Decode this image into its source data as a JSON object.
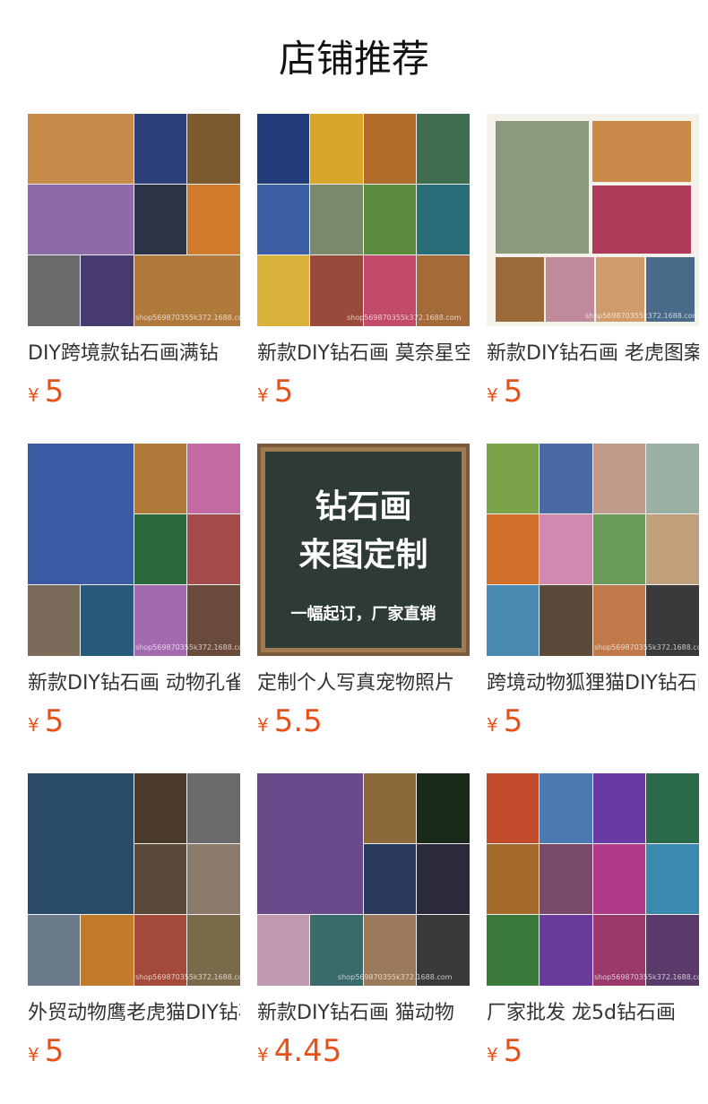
{
  "header": {
    "title": "店铺推荐"
  },
  "products": [
    {
      "title": "DIY跨境款钻石画满钻",
      "currency": "¥",
      "price": "5",
      "watermark": "shop569870355k372.1688.com",
      "tiles": [
        "#c98b4a",
        "#2c3f7a",
        "#7a5a2e",
        "#8d6aa8",
        "#2b3346",
        "#d07a2c",
        "#6a6a6a",
        "#463a6e",
        "#b07a3c"
      ]
    },
    {
      "title": "新款DIY钻石画 莫奈星空",
      "currency": "¥",
      "price": "5",
      "watermark": "shop569870355k372.1688.com",
      "tiles": [
        "#233d7a",
        "#d9a62b",
        "#b06a2a",
        "#3f6e4e",
        "#3e5fa3",
        "#7a8a6a",
        "#5c8a3e",
        "#2a6e7a",
        "#d9b23b",
        "#9a4a3a",
        "#c24a6a",
        "#a36a3a"
      ]
    },
    {
      "title": "新款DIY钻石画 老虎图案",
      "currency": "¥",
      "price": "5",
      "watermark": "shop569870355k372.1688.com",
      "tiles": [
        "#8a9a7a",
        "#c98a4a",
        "#b03a5a",
        "#9a6a3a",
        "#c08a9a",
        "#d09a6a",
        "#4a6a8a"
      ]
    },
    {
      "title": "新款DIY钻石画 动物孔雀",
      "currency": "¥",
      "price": "5",
      "watermark": "shop569870355k372.1688.com",
      "tiles": [
        "#3a5aa3",
        "#b07a3a",
        "#c46aa3",
        "#2a6a3a",
        "#a34a4a",
        "#7a6a5a",
        "#2a5a7a",
        "#a36ab0",
        "#6a4a3a"
      ]
    },
    {
      "title": "定制个人写真宠物照片",
      "currency": "¥",
      "price": "5.5",
      "custom": {
        "line1": "钻石画",
        "line2": "来图定制",
        "line3": "一幅起订，厂家直销"
      }
    },
    {
      "title": "跨境动物狐狸猫DIY钻石画",
      "currency": "¥",
      "price": "5",
      "watermark": "shop569870355k372.1688.com",
      "tiles": [
        "#7aa34a",
        "#4a6aa3",
        "#c09a8a",
        "#9ab0a3",
        "#d0702a",
        "#d08ab0",
        "#6a9a5a",
        "#c0a07a",
        "#4a8ab0",
        "#5a4a3a",
        "#c07a4a",
        "#3a3a3a"
      ]
    },
    {
      "title": "外贸动物鹰老虎猫DIY钻石画",
      "currency": "¥",
      "price": "5",
      "watermark": "shop569870355k372.1688.com",
      "tiles": [
        "#2a4a6a",
        "#4a3a2a",
        "#6a6a6a",
        "#5a4a3a",
        "#8a7a6a",
        "#6a7a8a",
        "#c07a2a",
        "#a34a3a",
        "#7a6a4a"
      ]
    },
    {
      "title": "新款DIY钻石画 猫动物",
      "currency": "¥",
      "price": "4.45",
      "watermark": "shop569870355k372.1688.com",
      "tiles": [
        "#6a4a8a",
        "#8a6a3a",
        "#1a2a1a",
        "#2a3a5a",
        "#2a2a3a",
        "#c09ab0",
        "#3a6a6a",
        "#9a7a5a",
        "#3a3a3a"
      ]
    },
    {
      "title": "厂家批发 龙5d钻石画",
      "currency": "¥",
      "price": "5",
      "watermark": "shop569870355k372.1688.com",
      "tiles": [
        "#c04a2a",
        "#4a7ab0",
        "#6a3aa3",
        "#2a6a4a",
        "#a36a2a",
        "#7a4a6a",
        "#b03a8a",
        "#3a8ab0",
        "#3a7a3a",
        "#6a3a9a",
        "#9a3a6a",
        "#5a3a6a"
      ]
    }
  ]
}
